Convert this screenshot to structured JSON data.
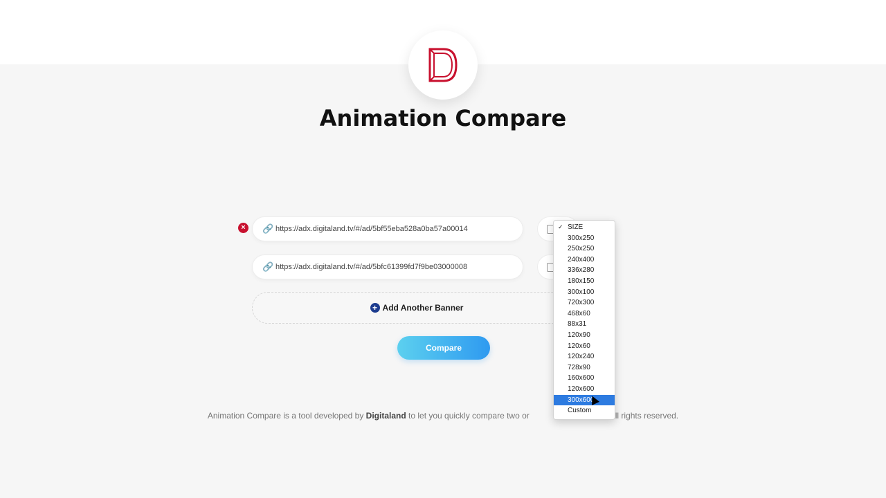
{
  "app": {
    "title": "Animation Compare"
  },
  "banners": [
    {
      "url": "https://adx.digitaland.tv/#/ad/5bf55eba528a0ba57a00014",
      "removable": true
    },
    {
      "url": "https://adx.digitaland.tv/#/ad/5bfc61399fd7f9be03000008",
      "removable": false
    }
  ],
  "actions": {
    "add_banner_label": "Add Another Banner",
    "compare_label": "Compare"
  },
  "footer": {
    "text_before": "Animation Compare is a tool developed by ",
    "brand": "Digitaland",
    "text_after": " to let you quickly compare two or",
    "rights": ". All rights reserved."
  },
  "size_dropdown": {
    "checked": "SIZE",
    "highlighted": "300x600",
    "options": [
      "SIZE",
      "300x250",
      "250x250",
      "240x400",
      "336x280",
      "180x150",
      "300x100",
      "720x300",
      "468x60",
      "88x31",
      "120x90",
      "120x60",
      "120x240",
      "728x90",
      "160x600",
      "120x600",
      "300x600",
      "Custom"
    ]
  },
  "colors": {
    "brand_red": "#c8102e",
    "accent_blue": "#2f9af0",
    "highlight": "#2d7be0"
  }
}
